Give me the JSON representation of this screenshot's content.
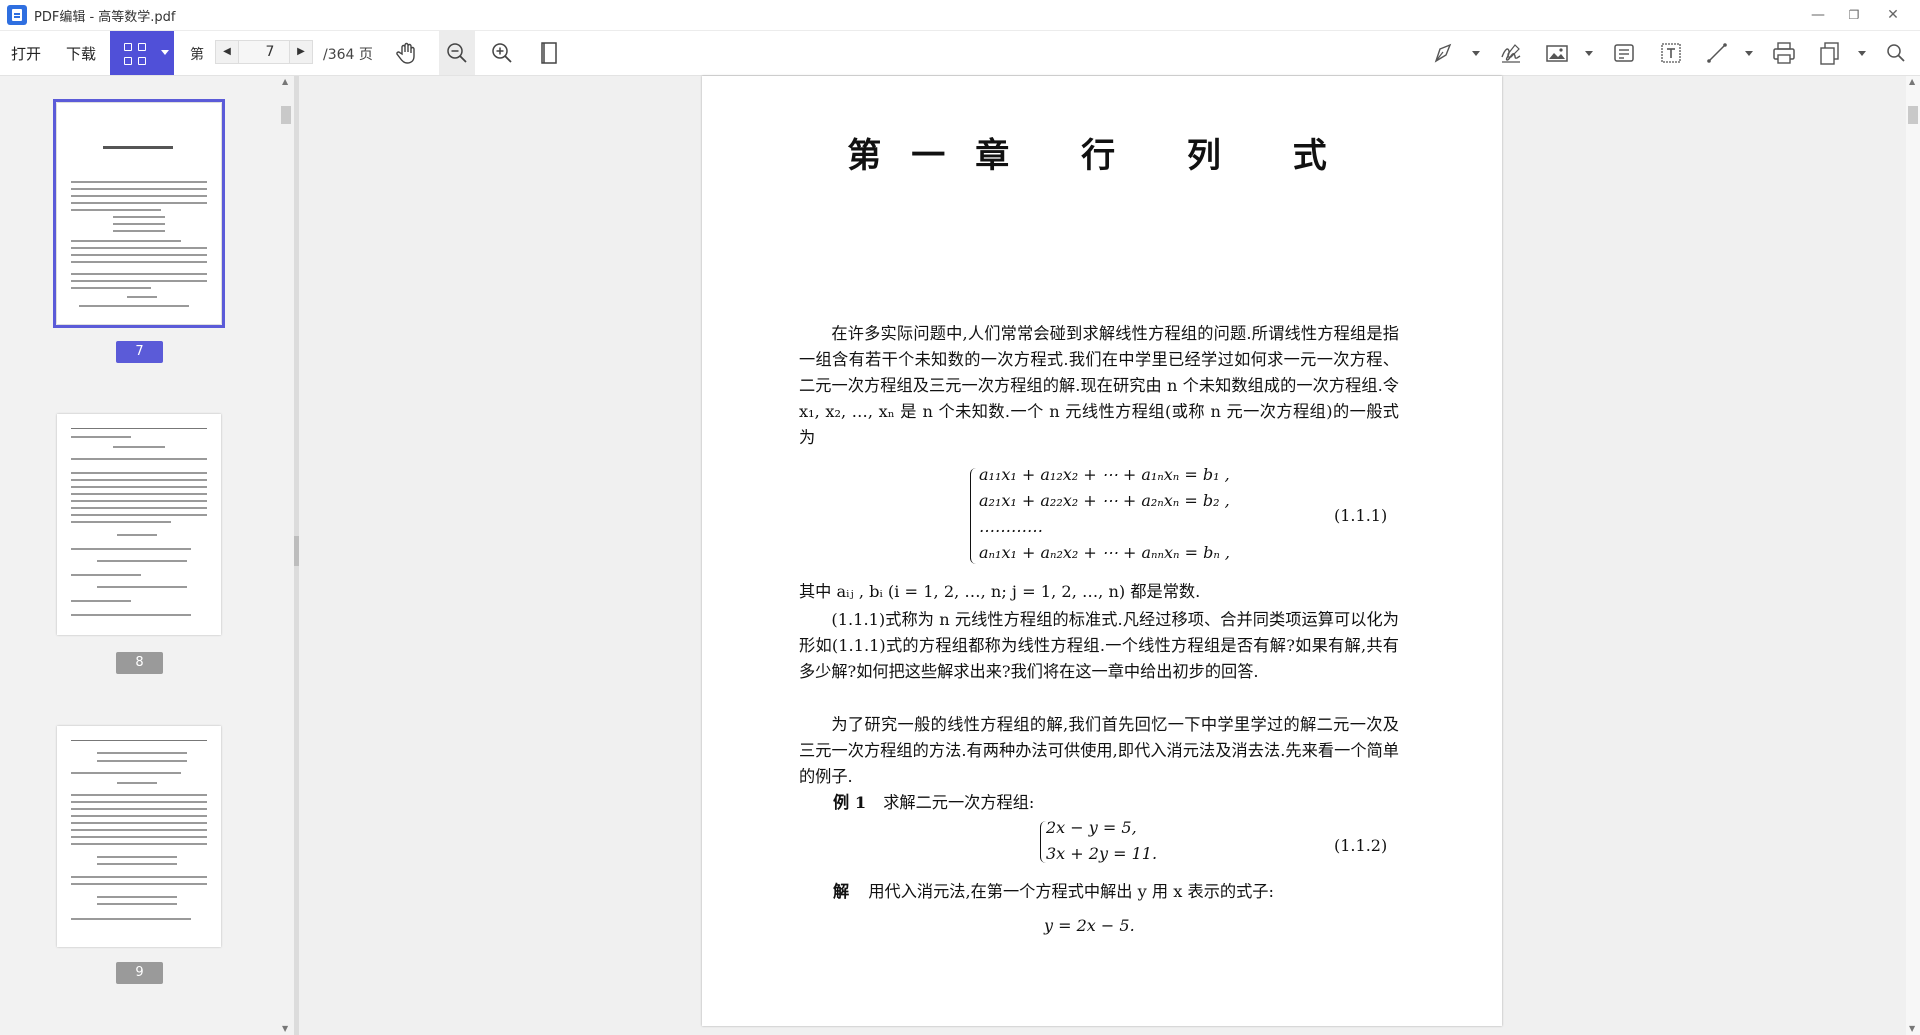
{
  "window": {
    "title": "PDF编辑 - 高等数学.pdf",
    "minimize_label": "—",
    "restore_label": "❐",
    "close_label": "✕"
  },
  "toolbar": {
    "open_label": "打开",
    "download_label": "下载",
    "page_prefix": "第",
    "current_page": "7",
    "total_pages": "/364 页",
    "accent_color": "#5050d8"
  },
  "icons": {
    "hand": "hand-icon",
    "zoom_out": "zoom-out-icon",
    "zoom_in": "zoom-in-icon",
    "single_page": "single-page-icon",
    "highlight": "highlight-pen-icon",
    "signature": "signature-icon",
    "image": "image-icon",
    "note": "note-icon",
    "textbox": "textbox-icon",
    "line": "line-icon",
    "print": "print-icon",
    "export": "export-icon",
    "search": "search-icon"
  },
  "sidebar": {
    "thumbnails": [
      {
        "label": "7",
        "selected": true,
        "badge_color": "#5b5bd8"
      },
      {
        "label": "8",
        "selected": false,
        "badge_color": "#9a9a9a"
      },
      {
        "label": "9",
        "selected": false,
        "badge_color": "#9a9a9a"
      }
    ]
  },
  "document": {
    "chapter_title": "第一章 行 列 式",
    "para1": "在许多实际问题中,人们常常会碰到求解线性方程组的问题.所谓线性方程组是指一组含有若干个未知数的一次方程式.我们在中学里已经学过如何求一元一次方程、二元一次方程组及三元一次方程组的解.现在研究由 n 个未知数组成的一次方程组.令 x₁, x₂, …, xₙ 是 n 个未知数.一个 n 元线性方程组(或称 n 元一次方程组)的一般式为",
    "eq1_lines": [
      "a₁₁x₁ + a₁₂x₂ + ⋯ + a₁ₙxₙ = b₁ ,",
      "a₂₁x₁ + a₂₂x₂ + ⋯ + a₂ₙxₙ = b₂ ,",
      "…………",
      "aₙ₁x₁ + aₙ₂x₂ + ⋯ + aₙₙxₙ = bₙ ,"
    ],
    "eq1_number": "(1.1.1)",
    "para2": "其中 aᵢⱼ , bᵢ (i = 1, 2, …, n; j = 1, 2, …, n) 都是常数.",
    "para3": "(1.1.1)式称为 n 元线性方程组的标准式.凡经过移项、合并同类项运算可以化为形如(1.1.1)式的方程组都称为线性方程组.一个线性方程组是否有解?如果有解,共有多少解?如何把这些解求出来?我们将在这一章中给出初步的回答.",
    "para4": "为了研究一般的线性方程组的解,我们首先回忆一下中学里学过的解二元一次及三元一次方程组的方法.有两种办法可供使用,即代入消元法及消去法.先来看一个简单的例子.",
    "example_label": "例 1",
    "example_text": "求解二元一次方程组:",
    "eq2_lines": [
      "2x − y = 5,",
      "3x + 2y = 11."
    ],
    "eq2_number": "(1.1.2)",
    "solution_label": "解",
    "solution_text": "用代入消元法,在第一个方程式中解出 y 用 x 表示的式子:",
    "eq3": "y = 2x − 5."
  }
}
